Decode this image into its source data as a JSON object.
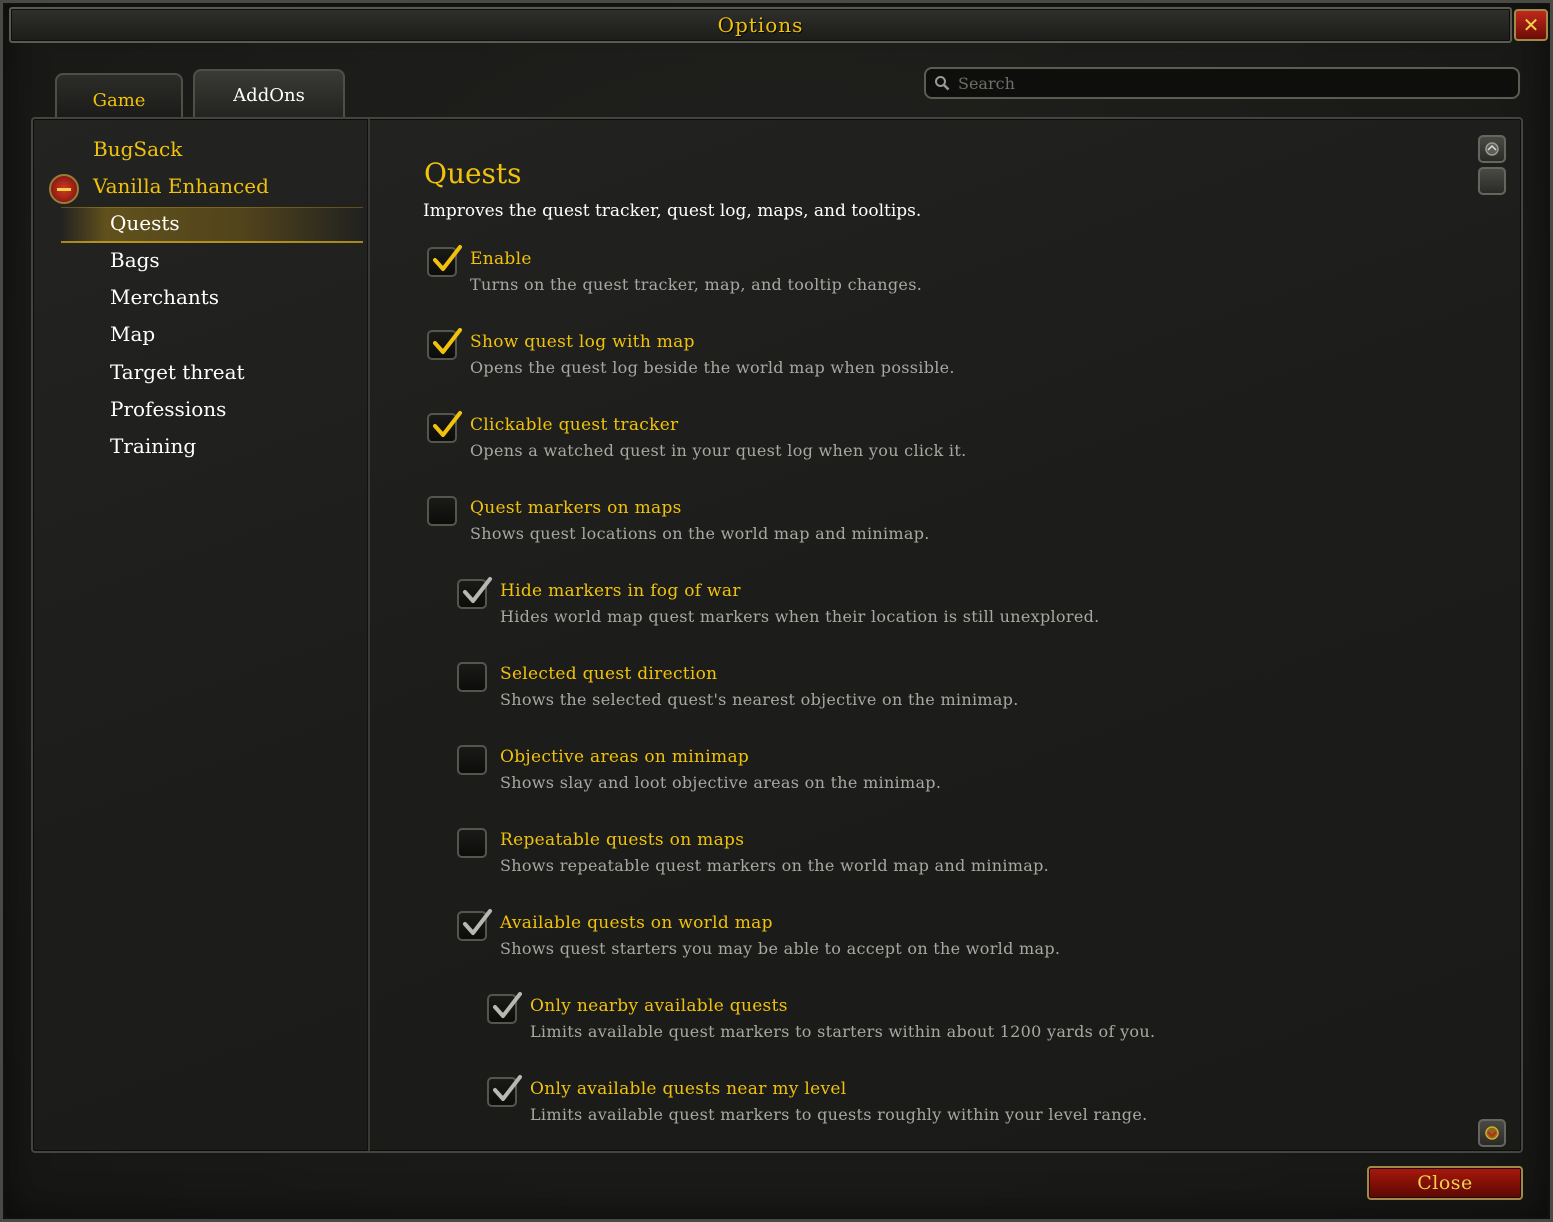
{
  "window": {
    "title": "Options",
    "close_glyph": "✕"
  },
  "tabs": [
    {
      "label": "Game",
      "active": false
    },
    {
      "label": "AddOns",
      "active": true
    }
  ],
  "search": {
    "placeholder": "Search",
    "value": ""
  },
  "sidebar": {
    "categories": [
      {
        "label": "BugSack",
        "expanded": false
      },
      {
        "label": "Vanilla Enhanced",
        "expanded": true
      }
    ],
    "subitems": [
      "Quests",
      "Bags",
      "Merchants",
      "Map",
      "Target threat",
      "Professions",
      "Training"
    ],
    "selected": "Quests"
  },
  "main": {
    "title": "Quests",
    "description": "Improves the quest tracker, quest log, maps, and tooltips.",
    "options": [
      {
        "label": "Enable",
        "desc": "Turns on the quest tracker, map, and tooltip changes.",
        "checked": true,
        "level": 0
      },
      {
        "label": "Show quest log with map",
        "desc": "Opens the quest log beside the world map when possible.",
        "checked": true,
        "level": 0
      },
      {
        "label": "Clickable quest tracker",
        "desc": "Opens a watched quest in your quest log when you click it.",
        "checked": true,
        "level": 0
      },
      {
        "label": "Quest markers on maps",
        "desc": "Shows quest locations on the world map and minimap.",
        "checked": false,
        "level": 0
      },
      {
        "label": "Hide markers in fog of war",
        "desc": "Hides world map quest markers when their location is still unexplored.",
        "checked": true,
        "level": 1,
        "disabled": true
      },
      {
        "label": "Selected quest direction",
        "desc": "Shows the selected quest's nearest objective on the minimap.",
        "checked": false,
        "level": 1
      },
      {
        "label": "Objective areas on minimap",
        "desc": "Shows slay and loot objective areas on the minimap.",
        "checked": false,
        "level": 1
      },
      {
        "label": "Repeatable quests on maps",
        "desc": "Shows repeatable quest markers on the world map and minimap.",
        "checked": false,
        "level": 1
      },
      {
        "label": "Available quests on world map",
        "desc": "Shows quest starters you may be able to accept on the world map.",
        "checked": true,
        "level": 1,
        "disabled": true
      },
      {
        "label": "Only nearby available quests",
        "desc": "Limits available quest markers to starters within about 1200 yards of you.",
        "checked": true,
        "level": 2,
        "disabled": true
      },
      {
        "label": "Only available quests near my level",
        "desc": "Limits available quest markers to quests roughly within your level range.",
        "checked": true,
        "level": 2,
        "disabled": true
      }
    ]
  },
  "footer": {
    "close_label": "Close"
  },
  "colors": {
    "gold": "#f0c20c",
    "white": "#ffffff",
    "desc_gray": "#a8a8a2",
    "red_button": "#a8180c"
  }
}
